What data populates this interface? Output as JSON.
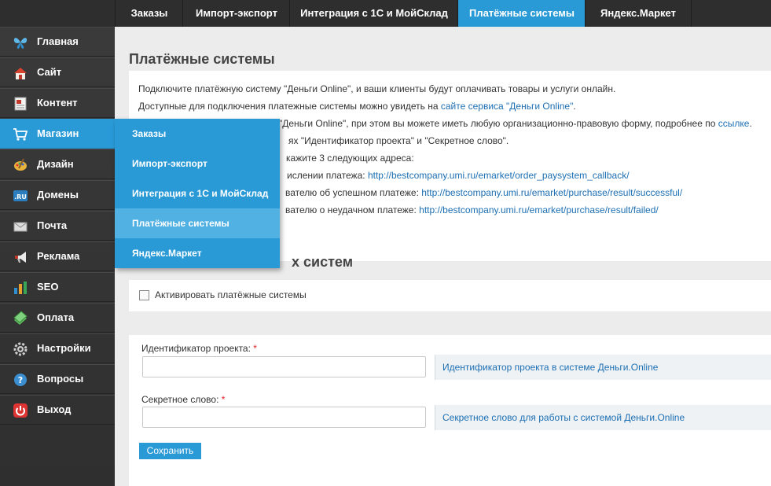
{
  "topnav": {
    "tabs": [
      {
        "label": "Заказы"
      },
      {
        "label": "Импорт-экспорт"
      },
      {
        "label": "Интеграция с 1С и МойСклад"
      },
      {
        "label": "Платёжные системы",
        "active": true
      },
      {
        "label": "Яндекс.Маркет"
      }
    ]
  },
  "sidebar": {
    "items": [
      {
        "label": "Главная",
        "icon": "butterfly-icon"
      },
      {
        "label": "Сайт",
        "icon": "home-icon"
      },
      {
        "label": "Контент",
        "icon": "document-icon"
      },
      {
        "label": "Магазин",
        "icon": "cart-icon",
        "active": true
      },
      {
        "label": "Дизайн",
        "icon": "palette-icon"
      },
      {
        "label": "Домены",
        "icon": "domain-ru-icon"
      },
      {
        "label": "Почта",
        "icon": "mail-icon"
      },
      {
        "label": "Реклама",
        "icon": "megaphone-icon"
      },
      {
        "label": "SEO",
        "icon": "bar-chart-icon"
      },
      {
        "label": "Оплата",
        "icon": "money-icon"
      },
      {
        "label": "Настройки",
        "icon": "gear-icon"
      },
      {
        "label": "Вопросы",
        "icon": "question-icon"
      },
      {
        "label": "Выход",
        "icon": "power-icon"
      }
    ]
  },
  "dropdown": {
    "items": [
      {
        "label": "Заказы"
      },
      {
        "label": "Импорт-экспорт"
      },
      {
        "label": "Интеграция с 1С и МойСклад"
      },
      {
        "label": "Платёжные системы",
        "highlighted": true
      },
      {
        "label": "Яндекс.Маркет"
      }
    ]
  },
  "main": {
    "title": "Платёжные системы",
    "info": {
      "line1": "Подключите платёжную систему \"Деньги Online\", и ваши клиенты будут оплачивать товары и услуги онлайн.",
      "line2_text": "Доступные для подключения платежные системы можно увидеть на ",
      "line2_link": "сайте сервиса \"Деньги Online\"",
      "line2_end": ".",
      "line3_text": "\"Деньги Online\", при этом вы можете иметь любую организационно-правовую форму, подробнее по ",
      "line3_link": "ссылке",
      "line3_end": ".",
      "line4": "ях \"Идентификатор проекта\" и \"Секретное слово\".",
      "line5": "кажите 3 следующих адреса:",
      "line6_text": "ислении платежа: ",
      "line6_link": "http://bestcompany.umi.ru/emarket/order_paysystem_callback/",
      "line7_text": "вателю об успешном платеже: ",
      "line7_link": "http://bestcompany.umi.ru/emarket/purchase/result/successful/",
      "line8_text": "вателю о неудачном платеже: ",
      "line8_link": "http://bestcompany.umi.ru/emarket/purchase/result/failed/"
    },
    "section_title": "х систем",
    "activate_label": "Активировать платёжные системы",
    "form": {
      "project_id_label": "Идентификатор проекта:",
      "project_id_value": "",
      "project_id_hint": "Идентификатор проекта в системе Деньги.Online",
      "secret_label": "Секретное слово:",
      "secret_value": "",
      "secret_hint": "Секретное слово для работы с системой Деньги.Online",
      "required_mark": "*",
      "save_label": "Сохранить"
    }
  },
  "colors": {
    "accent": "#2a9ad7",
    "highlight": "#52b1e3",
    "link": "#1d6fb3",
    "sidebar_bg": "#333333"
  }
}
